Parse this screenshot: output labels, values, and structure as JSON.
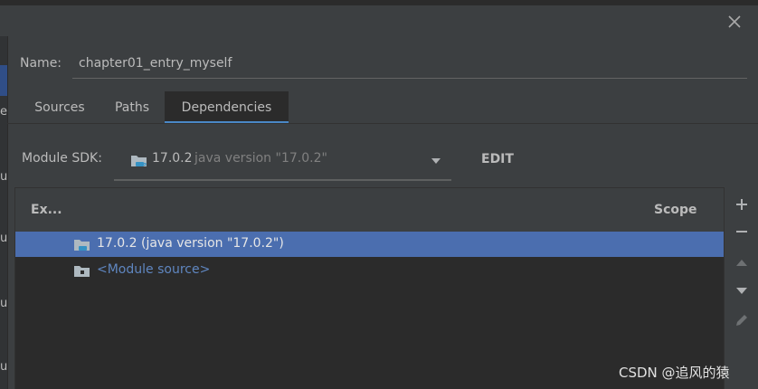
{
  "dialog": {
    "close_label": "Close"
  },
  "left_strip": {
    "fragments": [
      "e",
      "u",
      "u",
      "u",
      "u"
    ]
  },
  "name": {
    "label": "Name:",
    "value": "chapter01_entry_myself"
  },
  "tabs": [
    {
      "label": "Sources",
      "active": false
    },
    {
      "label": "Paths",
      "active": false
    },
    {
      "label": "Dependencies",
      "active": true
    }
  ],
  "sdk": {
    "label": "Module SDK:",
    "selected_version": "17.0.2",
    "selected_hint": "java version \"17.0.2\"",
    "edit_label": "EDIT"
  },
  "dependencies": {
    "columns": {
      "export": "Ex...",
      "scope": "Scope"
    },
    "rows": [
      {
        "label": "17.0.2 (java version \"17.0.2\")",
        "selected": true,
        "icon": "jdk-folder-icon"
      },
      {
        "label": "<Module source>",
        "selected": false,
        "icon": "module-source-icon"
      }
    ]
  },
  "toolbar": {
    "icons": [
      "plus-icon",
      "minus-icon",
      "arrow-up-icon",
      "arrow-down-icon",
      "pencil-icon"
    ]
  },
  "colors": {
    "accent": "#4a88c7",
    "selection": "#4b6eaf",
    "link": "#5f86c0"
  },
  "watermark": "CSDN @追风的猿"
}
